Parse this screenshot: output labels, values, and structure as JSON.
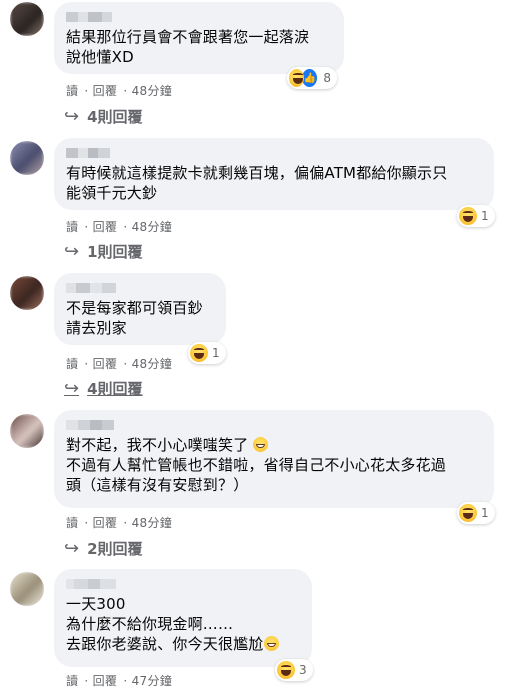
{
  "comments": [
    {
      "text": "結果那位行員會不會跟著您一起落淚\n說他懂XD",
      "reaction_count": "8",
      "reactions": [
        "haha-icon",
        "like-icon"
      ],
      "read_label": "讀",
      "reply_label": "回覆",
      "time": "48分鐘",
      "replies_label": "4則回覆"
    },
    {
      "text": "有時候就這樣提款卡就剩幾百塊，偏偏ATM都給你顯示只\n能領千元大鈔",
      "reaction_count": "1",
      "reactions": [
        "haha-icon"
      ],
      "read_label": "讀",
      "reply_label": "回覆",
      "time": "48分鐘",
      "replies_label": "1則回覆"
    },
    {
      "text": "不是每家都可領百鈔\n請去別家",
      "reaction_count": "1",
      "reactions": [
        "haha-icon"
      ],
      "read_label": "讀",
      "reply_label": "回覆",
      "time": "48分鐘",
      "replies_label": "4則回覆"
    },
    {
      "text_line1": "對不起，我不小心噗嗤笑了",
      "text_rest": "不過有人幫忙管帳也不錯啦，省得自己不小心花太多花過\n頭（這樣有沒有安慰到？）",
      "reaction_count": "1",
      "reactions": [
        "haha-icon"
      ],
      "read_label": "讀",
      "reply_label": "回覆",
      "time": "48分鐘",
      "replies_label": "2則回覆"
    },
    {
      "text_main": "一天300\n為什麼不給你現金啊……\n去跟你老婆說、你今天很尷尬",
      "reaction_count": "3",
      "reactions": [
        "haha-icon"
      ],
      "read_label": "讀",
      "reply_label": "回覆",
      "time": "47分鐘"
    }
  ],
  "colors": {
    "bubble": "#f0f2f5",
    "secondary_text": "#65676b",
    "like_blue": "#1877f2"
  }
}
